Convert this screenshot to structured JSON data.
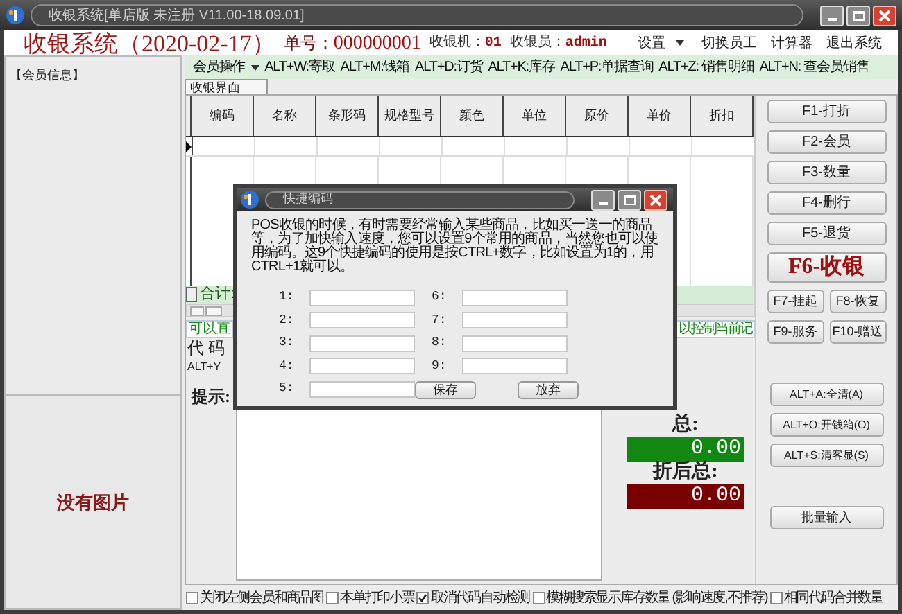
{
  "window": {
    "title": "收银系统[单店版 未注册 V11.00-18.09.01]"
  },
  "header": {
    "title": "收银系统（2020-02-17）",
    "fields": [
      {
        "label": "单号：",
        "value": "000000001",
        "kind": "large"
      },
      {
        "label": "收银机：",
        "value": "01",
        "kind": "small"
      },
      {
        "label": "收银员：",
        "value": "admin",
        "kind": "small"
      }
    ],
    "menu": [
      {
        "label": "设置",
        "dropdown": true
      },
      {
        "label": "切换员工",
        "dropdown": false
      },
      {
        "label": "计算器",
        "dropdown": false
      },
      {
        "label": "退出系统",
        "dropdown": false
      }
    ]
  },
  "left_panel": {
    "member_title": "【会员信息】",
    "image_placeholder": "没有图片"
  },
  "toolbar": [
    {
      "label": "会员操作",
      "dropdown": true
    },
    {
      "label": "ALT+W:寄取",
      "dropdown": false
    },
    {
      "label": "ALT+M:钱箱",
      "dropdown": false
    },
    {
      "label": "ALT+D:订货",
      "dropdown": false
    },
    {
      "label": "ALT+K:库存",
      "dropdown": false
    },
    {
      "label": "ALT+P:单据查询",
      "dropdown": false
    },
    {
      "label": "ALT+Z: 销售明细",
      "dropdown": false
    },
    {
      "label": "ALT+N: 查会员销售",
      "dropdown": false
    }
  ],
  "tabs": [
    {
      "label": "收银界面",
      "selected": true
    }
  ],
  "table": {
    "columns": [
      "编码",
      "名称",
      "条形码",
      "规格型号",
      "颜色",
      "单位",
      "原价",
      "单价",
      "折扣"
    ],
    "total_label": "合计:"
  },
  "hints": {
    "left": "可以直",
    "right": "以控制当前记"
  },
  "code_label": "代 码",
  "shortcut_hint": "ALT+Y",
  "prompt_label": "提示:",
  "totals": [
    {
      "label": "总:",
      "value": "0.00",
      "kind": "total"
    },
    {
      "label": "折后总:",
      "value": "0.00",
      "kind": "discounted"
    }
  ],
  "function_keys": [
    {
      "label": "F1-打折",
      "kind": "normal"
    },
    {
      "label": "F2-会员",
      "kind": "normal"
    },
    {
      "label": "F3-数量",
      "kind": "normal"
    },
    {
      "label": "F4-删行",
      "kind": "normal"
    },
    {
      "label": "F5-退货",
      "kind": "normal"
    },
    {
      "label": "F6-收银",
      "kind": "primary"
    },
    {
      "label": "F7-挂起",
      "kind": "half"
    },
    {
      "label": "F8-恢复",
      "kind": "half"
    },
    {
      "label": "F9-服务",
      "kind": "half"
    },
    {
      "label": "F10-赠送",
      "kind": "half"
    }
  ],
  "alt_keys": [
    "ALT+A:全清(A)",
    "ALT+O:开钱箱(O)",
    "ALT+S:清客显(S)"
  ],
  "batch_button": "批量输入",
  "checkboxes": [
    {
      "label": "关闭左侧会员和商品图",
      "checked": false
    },
    {
      "label": "本单打印小票",
      "checked": false
    },
    {
      "label": "取消代码自动检测",
      "checked": true
    },
    {
      "label": "模糊搜索显示库存数量 (影响速度,不推荐)",
      "checked": false
    },
    {
      "label": "相同代码合并数量",
      "checked": false
    }
  ],
  "dialog": {
    "title": "快捷编码",
    "description": "POS收银的时候，有时需要经常输入某些商品，比如买一送一的商品等，为了加快输入速度，您可以设置9个常用的商品，当然您也可以使用编码。这9个快捷编码的使用是按CTRL+数字，比如设置为1的，用CTRL+1就可以。",
    "fields": [
      {
        "label": "1:"
      },
      {
        "label": "2:"
      },
      {
        "label": "3:"
      },
      {
        "label": "4:"
      },
      {
        "label": "5:"
      },
      {
        "label": "6:"
      },
      {
        "label": "7:"
      },
      {
        "label": "8:"
      },
      {
        "label": "9:"
      }
    ],
    "buttons": [
      "保存",
      "放弃"
    ]
  }
}
